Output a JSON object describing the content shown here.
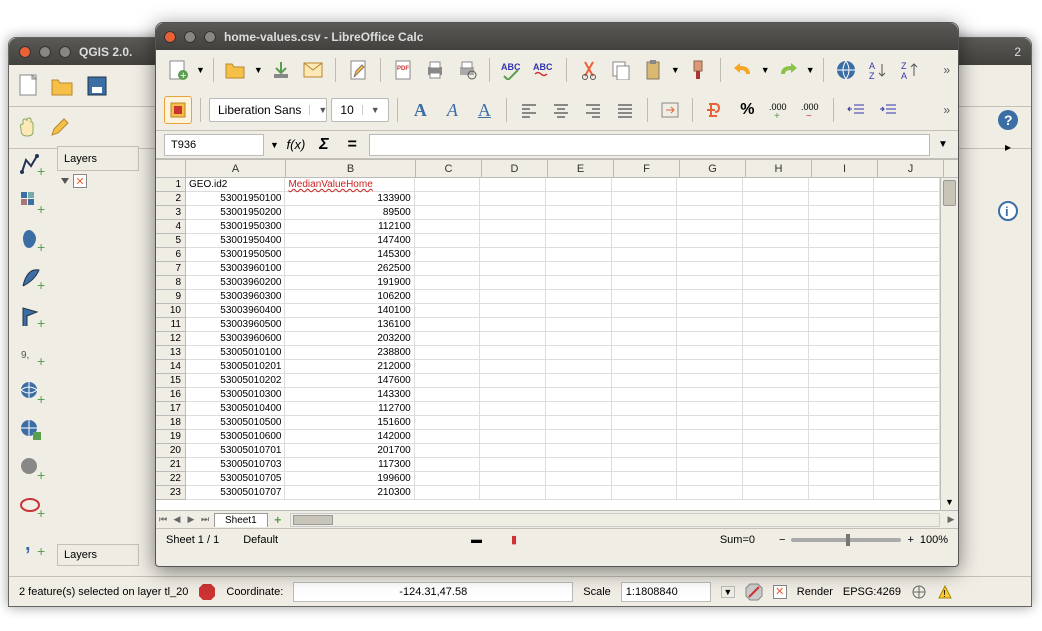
{
  "qgis": {
    "title": "QGIS 2.0.",
    "layers_label": "Layers",
    "layers_tab_bottom": "Layers",
    "status_selected": "2 feature(s) selected on layer tl_20",
    "coord_label": "Coordinate:",
    "coord_value": "-124.31,47.58",
    "scale_label": "Scale",
    "scale_value": "1:1808840",
    "render_label": "Render",
    "epsg": "EPSG:4269"
  },
  "lo": {
    "title": "home-values.csv - LibreOffice Calc",
    "font_name": "Liberation Sans",
    "font_size": "10",
    "cell_ref": "T936",
    "columns": [
      "A",
      "B",
      "C",
      "D",
      "E",
      "F",
      "G",
      "H",
      "I",
      "J"
    ],
    "header_row": {
      "A": "GEO.id2",
      "B": "MedianValueHome"
    },
    "rows": [
      {
        "n": 1
      },
      {
        "n": 2,
        "A": "53001950100",
        "B": "133900"
      },
      {
        "n": 3,
        "A": "53001950200",
        "B": "89500"
      },
      {
        "n": 4,
        "A": "53001950300",
        "B": "112100"
      },
      {
        "n": 5,
        "A": "53001950400",
        "B": "147400"
      },
      {
        "n": 6,
        "A": "53001950500",
        "B": "145300"
      },
      {
        "n": 7,
        "A": "53003960100",
        "B": "262500"
      },
      {
        "n": 8,
        "A": "53003960200",
        "B": "191900"
      },
      {
        "n": 9,
        "A": "53003960300",
        "B": "106200"
      },
      {
        "n": 10,
        "A": "53003960400",
        "B": "140100"
      },
      {
        "n": 11,
        "A": "53003960500",
        "B": "136100"
      },
      {
        "n": 12,
        "A": "53003960600",
        "B": "203200"
      },
      {
        "n": 13,
        "A": "53005010100",
        "B": "238800"
      },
      {
        "n": 14,
        "A": "53005010201",
        "B": "212000"
      },
      {
        "n": 15,
        "A": "53005010202",
        "B": "147600"
      },
      {
        "n": 16,
        "A": "53005010300",
        "B": "143300"
      },
      {
        "n": 17,
        "A": "53005010400",
        "B": "112700"
      },
      {
        "n": 18,
        "A": "53005010500",
        "B": "151600"
      },
      {
        "n": 19,
        "A": "53005010600",
        "B": "142000"
      },
      {
        "n": 20,
        "A": "53005010701",
        "B": "201700"
      },
      {
        "n": 21,
        "A": "53005010703",
        "B": "117300"
      },
      {
        "n": 22,
        "A": "53005010705",
        "B": "199600"
      },
      {
        "n": 23,
        "A": "53005010707",
        "B": "210300"
      }
    ],
    "sheet_tab": "Sheet1",
    "status_sheet": "Sheet 1 / 1",
    "status_style": "Default",
    "status_sum": "Sum=0",
    "status_zoom": "100%"
  }
}
